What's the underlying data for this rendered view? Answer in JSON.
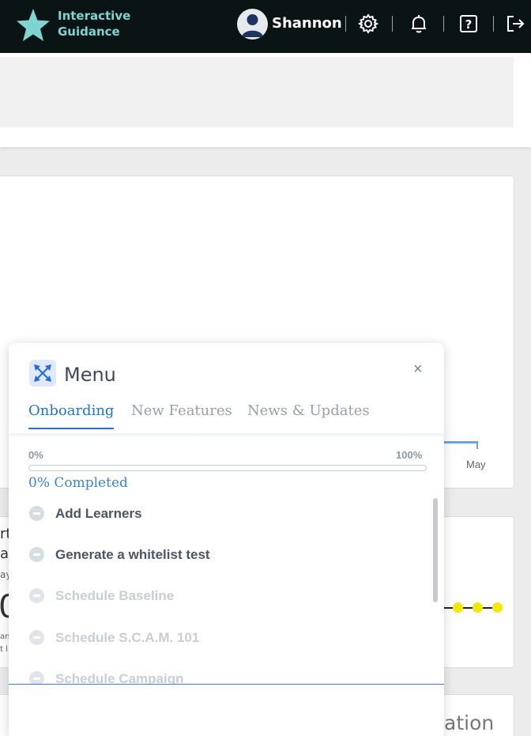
{
  "header": {
    "brand_line1": "Interactive",
    "brand_line2": "Guidance",
    "username": "Shannon",
    "icons": [
      "star-logo-icon",
      "avatar-icon",
      "gear-icon",
      "bell-icon",
      "help-icon",
      "logout-icon"
    ],
    "bg_color": "#0b1414",
    "brand_color": "#7fd3d0"
  },
  "background": {
    "chart_month_label": "May",
    "card_partial_text": "ation",
    "left_fragments": [
      "rt",
      "ai",
      "ay",
      "0",
      "an",
      "t l"
    ]
  },
  "menu": {
    "title": "Menu",
    "close_label": "×",
    "tabs": [
      {
        "label": "Onboarding",
        "active": true
      },
      {
        "label": "New Features",
        "active": false
      },
      {
        "label": "News & Updates",
        "active": false
      }
    ],
    "progress": {
      "min_label": "0%",
      "max_label": "100%",
      "value": 0,
      "completed_text": "0% Completed"
    },
    "items": [
      {
        "label": "Add Learners",
        "enabled": true
      },
      {
        "label": "Generate a whitelist test",
        "enabled": true
      },
      {
        "label": "Schedule Baseline",
        "enabled": false
      },
      {
        "label": "Schedule S.C.A.M. 101",
        "enabled": false
      },
      {
        "label": "Schedule Campaign",
        "enabled": false
      }
    ],
    "accent_color": "#1f75cf"
  }
}
